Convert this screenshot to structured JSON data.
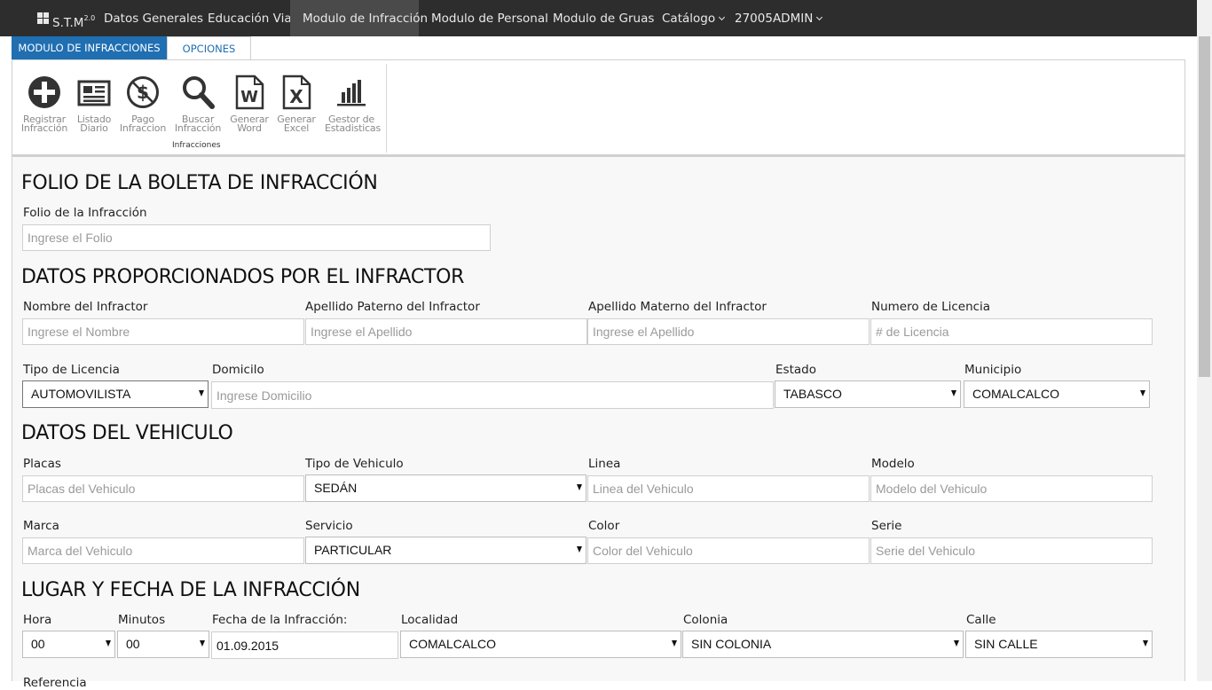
{
  "navbar": {
    "brand": "S.T.M",
    "brand_version": "2.0",
    "items": [
      {
        "label": "Datos Generales"
      },
      {
        "label": "Educación Vial"
      },
      {
        "label": "Modulo de Infracción"
      },
      {
        "label": "Modulo de Personal"
      },
      {
        "label": "Modulo de Gruas"
      },
      {
        "label": "Catálogo"
      },
      {
        "label": "27005ADMIN"
      }
    ]
  },
  "tabs": [
    {
      "label": "MODULO DE INFRACCIONES"
    },
    {
      "label": "OPCIONES"
    }
  ],
  "ribbon": {
    "buttons": [
      {
        "line1": "Registrar",
        "line2": "Infracción",
        "icon": "plus-circle-icon"
      },
      {
        "line1": "Listado",
        "line2": "Diario",
        "icon": "newspaper-icon"
      },
      {
        "line1": "Pago",
        "line2": "Infraccion",
        "icon": "dollar-cancel-icon"
      },
      {
        "line1": "Buscar",
        "line2": "Infracción",
        "icon": "search-icon"
      },
      {
        "line1": "Generar",
        "line2": "Word",
        "icon": "word-file-icon"
      },
      {
        "line1": "Generar",
        "line2": "Excel",
        "icon": "excel-file-icon"
      },
      {
        "line1": "Gestor de",
        "line2": "Estadisticas",
        "icon": "bar-chart-icon"
      }
    ],
    "group_label": "Infracciones"
  },
  "sections": {
    "folio": "FOLIO DE LA BOLETA DE INFRACCIÓN",
    "infractor": "DATOS PROPORCIONADOS POR EL INFRACTOR",
    "vehiculo": "DATOS DEL VEHICULO",
    "lugar": "LUGAR Y FECHA DE LA INFRACCIÓN"
  },
  "fields": {
    "folio": {
      "label": "Folio de la Infracción",
      "placeholder": "Ingrese el Folio"
    },
    "nombre": {
      "label": "Nombre del Infractor",
      "placeholder": "Ingrese el Nombre"
    },
    "apellido_paterno": {
      "label": "Apellido Paterno del Infractor",
      "placeholder": "Ingrese el Apellido"
    },
    "apellido_materno": {
      "label": "Apellido Materno del Infractor",
      "placeholder": "Ingrese el Apellido"
    },
    "licencia": {
      "label": "Numero de Licencia",
      "placeholder": "# de Licencia"
    },
    "tipo_licencia": {
      "label": "Tipo de Licencia",
      "value": "AUTOMOVILISTA"
    },
    "domicilio": {
      "label": "Domicilo",
      "placeholder": "Ingrese Domicilio"
    },
    "estado": {
      "label": "Estado",
      "value": "TABASCO"
    },
    "municipio": {
      "label": "Municipio",
      "value": "COMALCALCO"
    },
    "placas": {
      "label": "Placas",
      "placeholder": "Placas del Vehiculo"
    },
    "tipo_vehiculo": {
      "label": "Tipo de Vehiculo",
      "value": "SEDÁN"
    },
    "linea": {
      "label": "Linea",
      "placeholder": "Linea del Vehiculo"
    },
    "modelo": {
      "label": "Modelo",
      "placeholder": "Modelo del Vehiculo"
    },
    "marca": {
      "label": "Marca",
      "placeholder": "Marca del Vehiculo"
    },
    "servicio": {
      "label": "Servicio",
      "value": "PARTICULAR"
    },
    "color": {
      "label": "Color",
      "placeholder": "Color del Vehiculo"
    },
    "serie": {
      "label": "Serie",
      "placeholder": "Serie del Vehiculo"
    },
    "hora": {
      "label": "Hora",
      "value": "00"
    },
    "minutos": {
      "label": "Minutos",
      "value": "00"
    },
    "fecha": {
      "label": "Fecha de la Infracción:",
      "value": "01.09.2015"
    },
    "localidad": {
      "label": "Localidad",
      "value": "COMALCALCO"
    },
    "colonia": {
      "label": "Colonia",
      "value": "SIN COLONIA"
    },
    "calle": {
      "label": "Calle",
      "value": "SIN CALLE"
    },
    "referencia": {
      "label": "Referencia"
    }
  },
  "colors": {
    "navbar_bg": "#2d2d2d",
    "navbar_active_bg": "#4a4a4a",
    "tab_active_bg": "#1f6fb2",
    "icon_color": "#333333",
    "ribbon_label_color": "#8a8a8a"
  }
}
